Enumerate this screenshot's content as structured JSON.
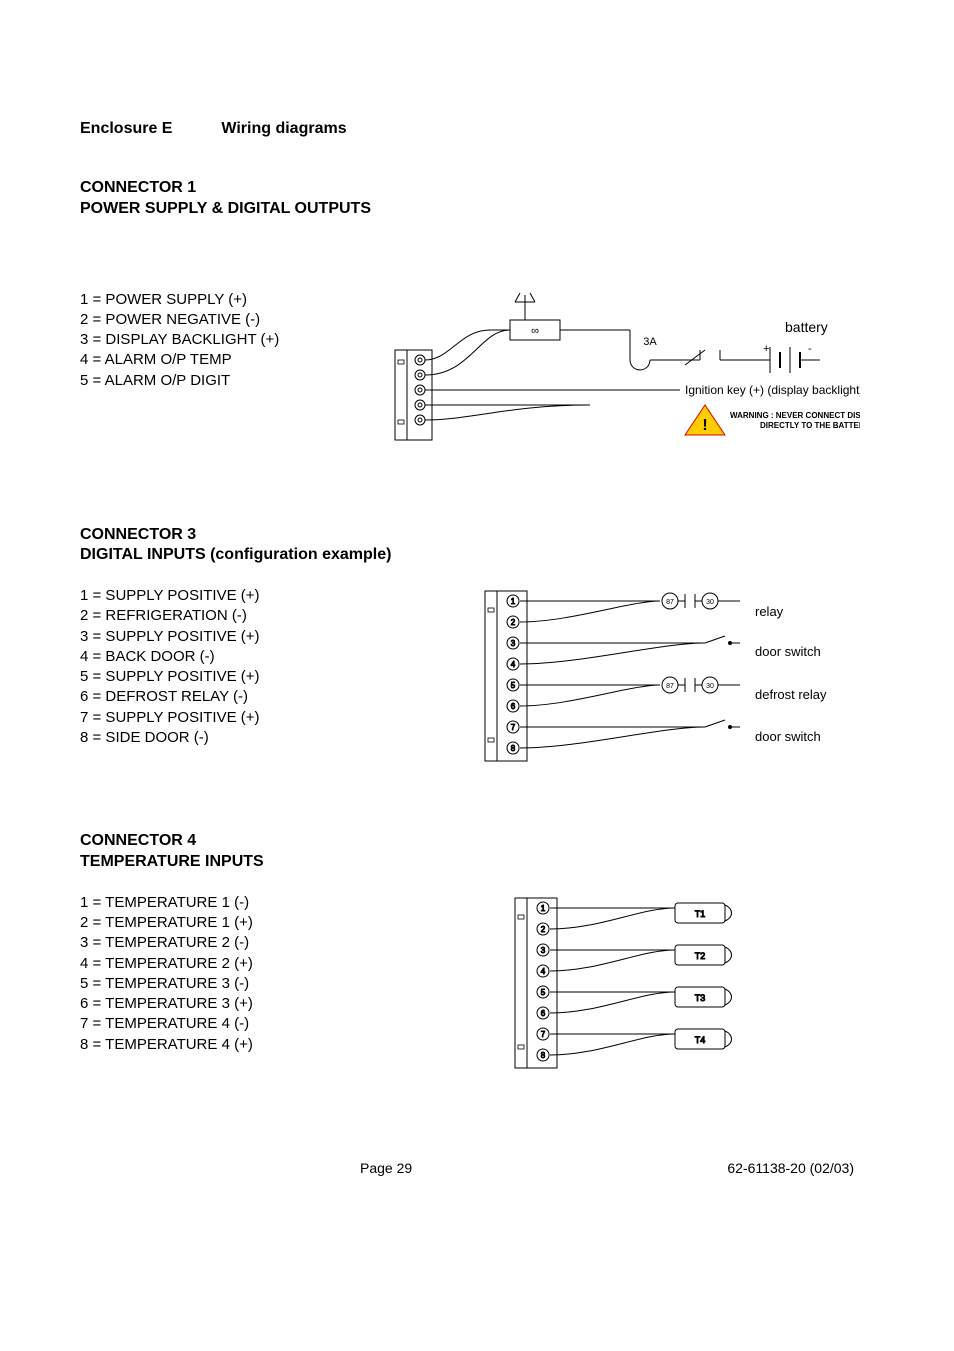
{
  "enclosure": {
    "label": "Enclosure E",
    "title": "Wiring diagrams"
  },
  "connector1": {
    "heading1": "CONNECTOR 1",
    "heading2": "POWER SUPPLY & DIGITAL OUTPUTS",
    "pins": [
      "1 = POWER SUPPLY (+)",
      "2 = POWER NEGATIVE (-)",
      "3 = DISPLAY BACKLIGHT (+)",
      "4 = ALARM O/P TEMP",
      "5 = ALARM O/P DIGIT"
    ],
    "labels": {
      "battery": "battery",
      "fuse": "3A",
      "ignition": "Ignition key (+) (display backlight)",
      "warning1": "WARNING : NEVER CONNECT DISPLAY BACKLIGHT",
      "warning2": "DIRECTLY TO THE BATTERY",
      "batt_plus": "+",
      "batt_minus": "-",
      "fuse_sym": "∞"
    }
  },
  "connector3": {
    "heading1": "CONNECTOR 3",
    "heading2": "DIGITAL INPUTS (configuration example)",
    "pins": [
      "1 = SUPPLY POSITIVE (+)",
      "2 = REFRIGERATION (-)",
      "3 = SUPPLY POSITIVE (+)",
      "4 = BACK DOOR (-)",
      "5 = SUPPLY POSITIVE (+)",
      "6 = DEFROST RELAY (-)",
      "7 = SUPPLY POSITIVE (+)",
      "8 = SIDE DOOR (-)"
    ],
    "labels": {
      "relay": "relay",
      "door_switch": "door switch",
      "defrost_relay": "defrost relay",
      "coil87": "87",
      "coil30": "30"
    }
  },
  "connector4": {
    "heading1": "CONNECTOR 4",
    "heading2": "TEMPERATURE INPUTS",
    "pins": [
      "1 = TEMPERATURE 1 (-)",
      "2 = TEMPERATURE 1 (+)",
      "3 = TEMPERATURE 2 (-)",
      "4 = TEMPERATURE 2 (+)",
      "5 = TEMPERATURE 3 (-)",
      "6 = TEMPERATURE 3 (+)",
      "7 = TEMPERATURE 4 (-)",
      "8 = TEMPERATURE 4 (+)"
    ],
    "labels": {
      "t1": "T1",
      "t2": "T2",
      "t3": "T3",
      "t4": "T4"
    }
  },
  "footer": {
    "page": "Page  29",
    "doc": "62-61138-20  (02/03)"
  }
}
